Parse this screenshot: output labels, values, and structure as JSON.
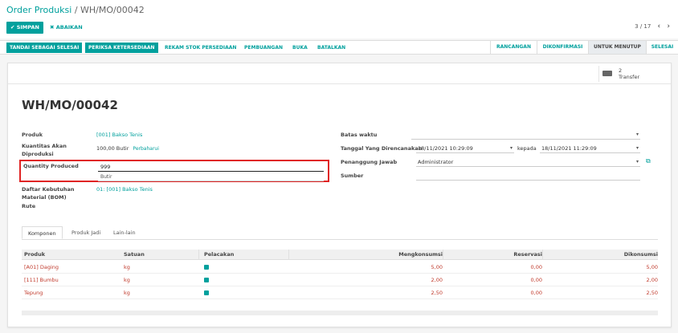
{
  "breadcrumb": {
    "parent": "Order Produksi",
    "separator": " / ",
    "current": "WH/MO/00042"
  },
  "toolbar": {
    "save_label": "✔ SIMPAN",
    "discard_label": "✖ ABAIKAN"
  },
  "pager": {
    "value": "3 / 17",
    "prev_icon": "‹",
    "next_icon": "›"
  },
  "actions": {
    "mark_done": "TANDAI SEBAGAI SELESAI",
    "check_availability": "PERIKSA KETERSEDIAAN",
    "stock_moves": "REKAM STOK PERSEDIAAN",
    "scrap": "PEMBUANGAN",
    "unlock": "BUKA",
    "cancel": "BATALKAN"
  },
  "stages": [
    "RANCANGAN",
    "DIKONFIRMASI",
    "UNTUK MENUTUP",
    "SELESAI"
  ],
  "active_stage": "UNTUK MENUTUP",
  "smart_button": {
    "count": "2",
    "label": "Transfer",
    "icon": "truck-icon"
  },
  "record": {
    "title": "WH/MO/00042"
  },
  "fields": {
    "product_label": "Produk",
    "product_value": "[001] Bakso Tenis",
    "qty_label_1": "Kuantitas Akan",
    "qty_label_2": "Diproduksi",
    "qty_value": "100,00 Butir",
    "qty_update": "Perbaharui",
    "qp_label": "Quantity Produced",
    "qp_value": "999",
    "qp_unit": "Butir",
    "bom_label_1": "Daftar Kebutuhan",
    "bom_label_2": "Material (BOM)",
    "bom_value": "01: [001] Bakso Tenis",
    "route_label": "Rute",
    "deadline_label": "Batas waktu",
    "deadline_value": "",
    "planned_label": "Tanggal Yang Direncanakan",
    "planned_from": "18/11/2021 10:29:09",
    "planned_to_label": "kepada",
    "planned_to": "18/11/2021 11:29:09",
    "responsible_label": "Penanggung Jawab",
    "responsible_value": "Administrator",
    "source_label": "Sumber",
    "source_value": ""
  },
  "tabs": [
    "Komponen",
    "Produk Jadi",
    "Lain-lain"
  ],
  "table": {
    "headers": [
      "Produk",
      "Satuan",
      "Pelacakan",
      "Mengkonsumsi",
      "Reservasi",
      "Dikonsumsi"
    ],
    "rows": [
      {
        "product": "[A01] Daging",
        "uom": "kg",
        "consume": "5,00",
        "reserved": "0,00",
        "consumed": "5,00"
      },
      {
        "product": "[111] Bumbu",
        "uom": "kg",
        "consume": "2,00",
        "reserved": "0,00",
        "consumed": "2,00"
      },
      {
        "product": "Tepung",
        "uom": "kg",
        "consume": "2,50",
        "reserved": "0,00",
        "consumed": "2,50"
      }
    ]
  },
  "colors": {
    "accent": "#00a09d",
    "highlight": "#e02424",
    "line_text": "#c0392b"
  }
}
